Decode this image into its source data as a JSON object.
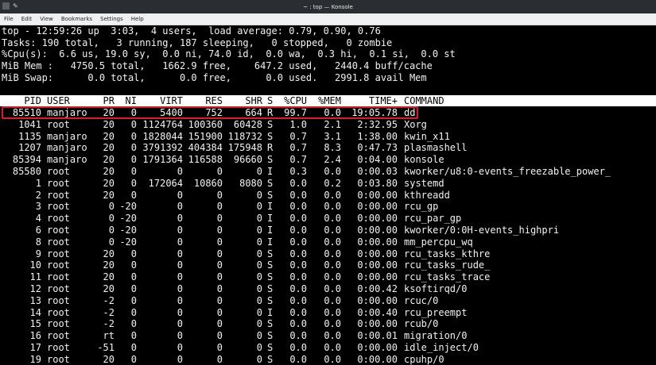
{
  "window": {
    "title": "~ : top — Konsole"
  },
  "menu": [
    "File",
    "Edit",
    "View",
    "Bookmarks",
    "Settings",
    "Help"
  ],
  "summary": [
    "top - 12:59:26 up  3:03,  4 users,  load average: 0.79, 0.90, 0.76",
    "Tasks: 190 total,   3 running, 187 sleeping,   0 stopped,   0 zombie",
    "%Cpu(s):  6.6 us, 19.0 sy,  0.0 ni, 74.0 id,  0.0 wa,  0.3 hi,  0.1 si,  0.0 st",
    "MiB Mem :   4750.5 total,   1662.9 free,    647.2 used,   2440.4 buff/cache",
    "MiB Swap:      0.0 total,      0.0 free,      0.0 used.   2991.8 avail Mem"
  ],
  "columns": [
    "PID",
    "USER",
    "PR",
    "NI",
    "VIRT",
    "RES",
    "SHR",
    "S",
    "%CPU",
    "%MEM",
    "TIME+",
    "COMMAND"
  ],
  "processes": [
    [
      "85510",
      "manjaro",
      "20",
      "0",
      "5400",
      "752",
      "664",
      "R",
      "99.7",
      "0.0",
      "19:05.78",
      "dd"
    ],
    [
      "1041",
      "root",
      "20",
      "0",
      "1124764",
      "100360",
      "60428",
      "S",
      "1.0",
      "2.1",
      "2:32.95",
      "Xorg"
    ],
    [
      "1135",
      "manjaro",
      "20",
      "0",
      "1828044",
      "151900",
      "118732",
      "S",
      "0.7",
      "3.1",
      "1:38.00",
      "kwin_x11"
    ],
    [
      "1207",
      "manjaro",
      "20",
      "0",
      "3791392",
      "404384",
      "175948",
      "R",
      "0.7",
      "8.3",
      "0:47.73",
      "plasmashell"
    ],
    [
      "85394",
      "manjaro",
      "20",
      "0",
      "1791364",
      "116588",
      "96660",
      "S",
      "0.7",
      "2.4",
      "0:04.00",
      "konsole"
    ],
    [
      "85580",
      "root",
      "20",
      "0",
      "0",
      "0",
      "0",
      "I",
      "0.3",
      "0.0",
      "0:00.03",
      "kworker/u8:0-events_freezable_power_"
    ],
    [
      "1",
      "root",
      "20",
      "0",
      "172064",
      "10860",
      "8080",
      "S",
      "0.0",
      "0.2",
      "0:03.80",
      "systemd"
    ],
    [
      "2",
      "root",
      "20",
      "0",
      "0",
      "0",
      "0",
      "S",
      "0.0",
      "0.0",
      "0:00.00",
      "kthreadd"
    ],
    [
      "3",
      "root",
      "0",
      "-20",
      "0",
      "0",
      "0",
      "I",
      "0.0",
      "0.0",
      "0:00.00",
      "rcu_gp"
    ],
    [
      "4",
      "root",
      "0",
      "-20",
      "0",
      "0",
      "0",
      "I",
      "0.0",
      "0.0",
      "0:00.00",
      "rcu_par_gp"
    ],
    [
      "6",
      "root",
      "0",
      "-20",
      "0",
      "0",
      "0",
      "I",
      "0.0",
      "0.0",
      "0:00.00",
      "kworker/0:0H-events_highpri"
    ],
    [
      "8",
      "root",
      "0",
      "-20",
      "0",
      "0",
      "0",
      "I",
      "0.0",
      "0.0",
      "0:00.00",
      "mm_percpu_wq"
    ],
    [
      "9",
      "root",
      "20",
      "0",
      "0",
      "0",
      "0",
      "S",
      "0.0",
      "0.0",
      "0:00.00",
      "rcu_tasks_kthre"
    ],
    [
      "10",
      "root",
      "20",
      "0",
      "0",
      "0",
      "0",
      "S",
      "0.0",
      "0.0",
      "0:00.00",
      "rcu_tasks_rude_"
    ],
    [
      "11",
      "root",
      "20",
      "0",
      "0",
      "0",
      "0",
      "S",
      "0.0",
      "0.0",
      "0:00.00",
      "rcu_tasks_trace"
    ],
    [
      "12",
      "root",
      "20",
      "0",
      "0",
      "0",
      "0",
      "S",
      "0.0",
      "0.0",
      "0:00.42",
      "ksoftirqd/0"
    ],
    [
      "13",
      "root",
      "-2",
      "0",
      "0",
      "0",
      "0",
      "S",
      "0.0",
      "0.0",
      "0:00.00",
      "rcuc/0"
    ],
    [
      "14",
      "root",
      "-2",
      "0",
      "0",
      "0",
      "0",
      "I",
      "0.0",
      "0.0",
      "0:00.40",
      "rcu_preempt"
    ],
    [
      "15",
      "root",
      "-2",
      "0",
      "0",
      "0",
      "0",
      "S",
      "0.0",
      "0.0",
      "0:00.00",
      "rcub/0"
    ],
    [
      "16",
      "root",
      "rt",
      "0",
      "0",
      "0",
      "0",
      "S",
      "0.0",
      "0.0",
      "0:00.01",
      "migration/0"
    ],
    [
      "17",
      "root",
      "-51",
      "0",
      "0",
      "0",
      "0",
      "S",
      "0.0",
      "0.0",
      "0:00.00",
      "idle_inject/0"
    ],
    [
      "19",
      "root",
      "20",
      "0",
      "0",
      "0",
      "0",
      "S",
      "0.0",
      "0.0",
      "0:00.00",
      "cpuhp/0"
    ]
  ],
  "colors": {
    "highlight": "#e0181f",
    "terminal_bg": "#000000",
    "terminal_fg": "#f2f2f2"
  }
}
